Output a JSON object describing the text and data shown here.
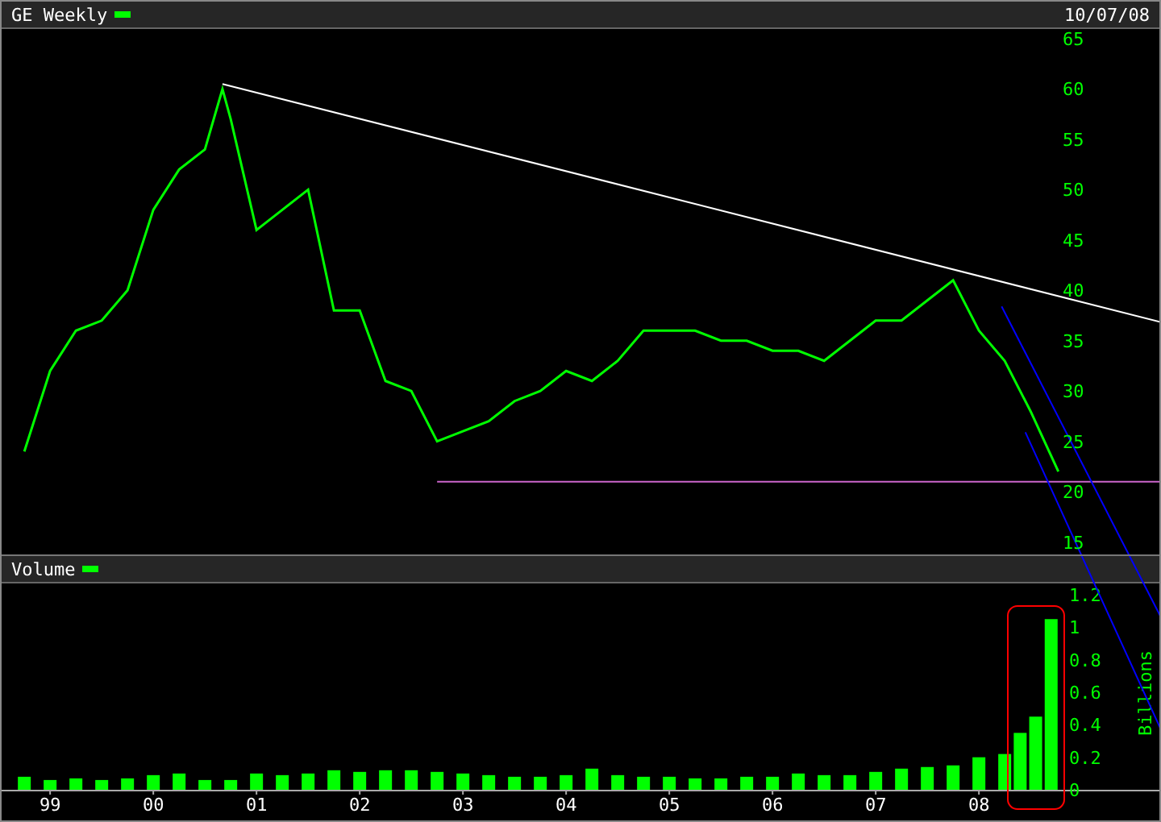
{
  "header": {
    "date": "10/07/08"
  },
  "price_chart": {
    "chart_data": {
      "type": "line",
      "xlim": [
        1998.53,
        2009.78
      ],
      "ylim": [
        15,
        65
      ],
      "yticks": [
        15,
        20,
        25,
        30,
        35,
        40,
        45,
        50,
        55,
        60,
        65
      ],
      "x": [
        1998.75,
        1999,
        1999.25,
        1999.5,
        1999.75,
        2000,
        2000.25,
        2000.5,
        2000.67,
        2000.75,
        2001,
        2001.25,
        2001.5,
        2001.75,
        2002,
        2002.25,
        2002.5,
        2002.75,
        2003,
        2003.25,
        2003.5,
        2003.75,
        2004,
        2004.25,
        2004.5,
        2004.75,
        2005,
        2005.25,
        2005.5,
        2005.75,
        2006,
        2006.25,
        2006.5,
        2006.75,
        2007,
        2007.25,
        2007.5,
        2007.75,
        2008,
        2008.25,
        2008.5,
        2008.77
      ],
      "series": [
        {
          "name": "GE Weekly",
          "color": "#00ff00",
          "values": [
            24,
            32,
            36,
            37,
            40,
            48,
            52,
            54,
            60,
            57,
            46,
            48,
            50,
            38,
            38,
            31,
            30,
            25,
            26,
            27,
            29,
            30,
            32,
            31,
            33,
            36,
            36,
            36,
            35,
            35,
            34,
            34,
            33,
            35,
            37,
            37,
            39,
            41,
            36,
            33,
            28,
            22
          ]
        }
      ]
    }
  },
  "volume_panel": {
    "chart_data": {
      "type": "bar",
      "ylabel": "Billions",
      "xlim": [
        1998.53,
        2009.78
      ],
      "ylim": [
        0,
        1.2
      ],
      "yticks": [
        0,
        0.2,
        0.4,
        0.6,
        0.8,
        1,
        1.2
      ],
      "xticks": [
        {
          "value": 1999,
          "label": "99"
        },
        {
          "value": 2000,
          "label": "00"
        },
        {
          "value": 2001,
          "label": "01"
        },
        {
          "value": 2002,
          "label": "02"
        },
        {
          "value": 2003,
          "label": "03"
        },
        {
          "value": 2004,
          "label": "04"
        },
        {
          "value": 2005,
          "label": "05"
        },
        {
          "value": 2006,
          "label": "06"
        },
        {
          "value": 2007,
          "label": "07"
        },
        {
          "value": 2008,
          "label": "08"
        }
      ],
      "x": [
        1998.75,
        1999,
        1999.25,
        1999.5,
        1999.75,
        2000,
        2000.25,
        2000.5,
        2000.75,
        2001,
        2001.25,
        2001.5,
        2001.75,
        2002,
        2002.25,
        2002.5,
        2002.75,
        2003,
        2003.25,
        2003.5,
        2003.75,
        2004,
        2004.25,
        2004.5,
        2004.75,
        2005,
        2005.25,
        2005.5,
        2005.75,
        2006,
        2006.25,
        2006.5,
        2006.75,
        2007,
        2007.25,
        2007.5,
        2007.75,
        2008,
        2008.25,
        2008.4,
        2008.55,
        2008.7
      ],
      "series": [
        {
          "name": "Volume",
          "color": "#00ff00",
          "values": [
            0.08,
            0.06,
            0.07,
            0.06,
            0.07,
            0.09,
            0.1,
            0.06,
            0.06,
            0.1,
            0.09,
            0.1,
            0.12,
            0.11,
            0.12,
            0.12,
            0.11,
            0.1,
            0.09,
            0.08,
            0.08,
            0.09,
            0.13,
            0.09,
            0.08,
            0.08,
            0.07,
            0.07,
            0.08,
            0.08,
            0.1,
            0.09,
            0.09,
            0.11,
            0.13,
            0.14,
            0.15,
            0.2,
            0.22,
            0.35,
            0.45,
            1.05
          ]
        }
      ]
    }
  }
}
